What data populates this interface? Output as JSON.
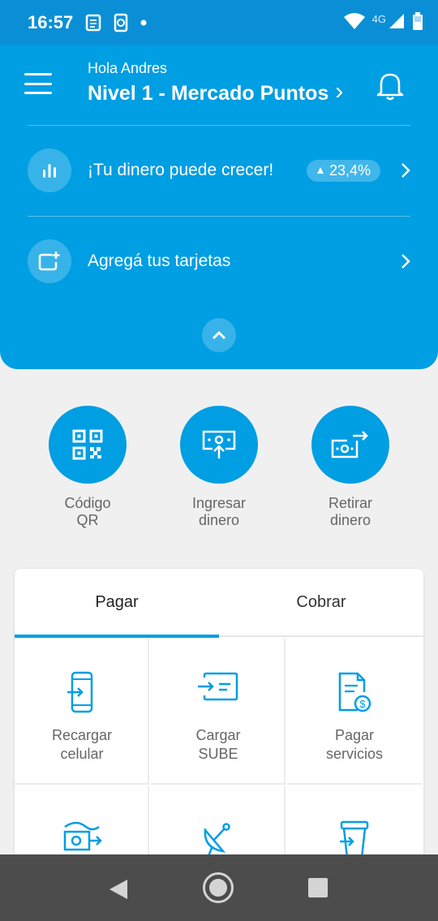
{
  "status_bar": {
    "time": "16:57",
    "network": "4G"
  },
  "header": {
    "greeting": "Hola Andres",
    "level": "Nivel 1 - Mercado Puntos",
    "level_chevron": "›"
  },
  "panel": {
    "invest": {
      "label": "¡Tu dinero puede crecer!",
      "badge": "23,4%"
    },
    "cards": {
      "label": "Agregá tus tarjetas"
    }
  },
  "actions": [
    {
      "label_line1": "Código",
      "label_line2": "QR",
      "icon": "qr-icon"
    },
    {
      "label_line1": "Ingresar",
      "label_line2": "dinero",
      "icon": "deposit-icon"
    },
    {
      "label_line1": "Retirar",
      "label_line2": "dinero",
      "icon": "withdraw-icon"
    }
  ],
  "tabs": [
    {
      "label": "Pagar",
      "active": true
    },
    {
      "label": "Cobrar",
      "active": false
    }
  ],
  "services": [
    {
      "line1": "Recargar",
      "line2": "celular",
      "icon": "phone-recharge-icon"
    },
    {
      "line1": "Cargar",
      "line2": "SUBE",
      "icon": "sube-card-icon"
    },
    {
      "line1": "Pagar",
      "line2": "servicios",
      "icon": "bill-payment-icon"
    },
    {
      "line1": "",
      "line2": "",
      "icon": "transfer-money-icon"
    },
    {
      "line1": "",
      "line2": "",
      "icon": "satellite-dish-icon"
    },
    {
      "line1": "",
      "line2": "",
      "icon": "transport-cup-icon"
    }
  ],
  "colors": {
    "primary": "#009ee3",
    "status_bar": "#0a8fd6",
    "background": "#f0f0f0",
    "nav_bar": "#4c4c4c"
  }
}
